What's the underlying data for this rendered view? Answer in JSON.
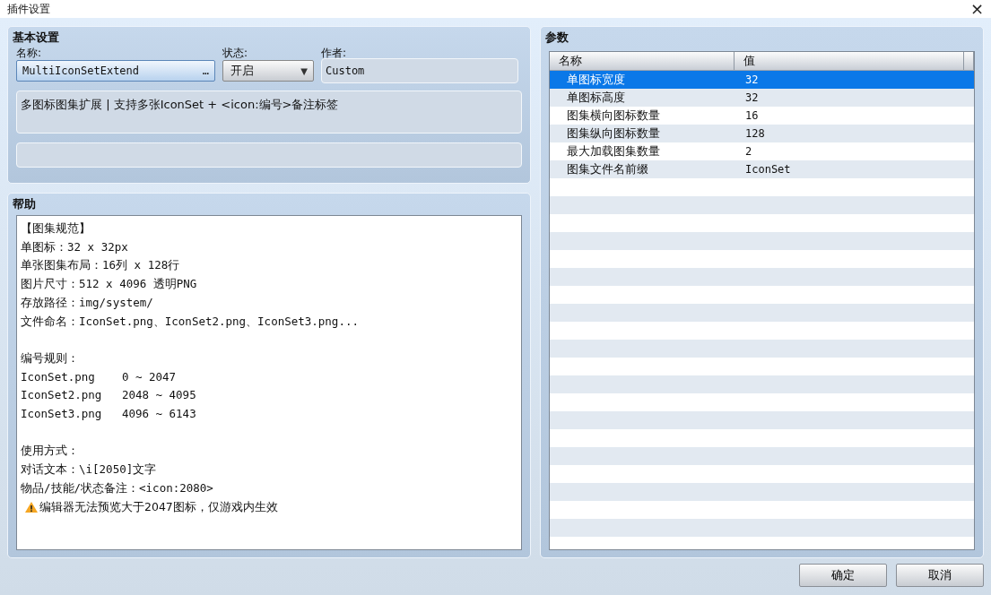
{
  "window": {
    "title": "插件设置",
    "close": "×"
  },
  "basic": {
    "title": "基本设置",
    "name": {
      "label": "名称:",
      "value": "MultiIconSetExtend",
      "button": "…"
    },
    "status": {
      "label": "状态:",
      "value": "开启",
      "arrow": "▼"
    },
    "author": {
      "label": "作者:",
      "value": "Custom"
    },
    "description": "多图标图集扩展 | 支持多张IconSet + <icon:编号>备注标签"
  },
  "help": {
    "title": "帮助",
    "paragraphs": [
      [
        "【图集规范】",
        "单图标：32 x 32px",
        "单张图集布局：16列 x 128行",
        "图片尺寸：512 x 4096 透明PNG",
        "存放路径：img/system/",
        "文件命名：IconSet.png、IconSet2.png、IconSet3.png..."
      ],
      [
        "编号规则：",
        "IconSet.png    0 ~ 2047",
        "IconSet2.png   2048 ~ 4095",
        "IconSet3.png   4096 ~ 6143"
      ],
      [
        "使用方式：",
        "对话文本：\\i[2050]文字",
        "物品/技能/状态备注：<icon:2080>",
        {
          "kind": "warning",
          "text": "编辑器无法预览大于2047图标，仅游戏内生效"
        }
      ]
    ]
  },
  "params": {
    "title": "参数",
    "columns": [
      "名称",
      "值"
    ],
    "rows": [
      {
        "name": "单图标宽度",
        "value": "32",
        "selected": true
      },
      {
        "name": "单图标高度",
        "value": "32",
        "selected": false
      },
      {
        "name": "图集横向图标数量",
        "value": "16",
        "selected": false
      },
      {
        "name": "图集纵向图标数量",
        "value": "128",
        "selected": false
      },
      {
        "name": "最大加载图集数量",
        "value": "2",
        "selected": false
      },
      {
        "name": "图集文件名前缀",
        "value": "IconSet",
        "selected": false
      }
    ]
  },
  "buttons": [
    "确定",
    "取消"
  ]
}
